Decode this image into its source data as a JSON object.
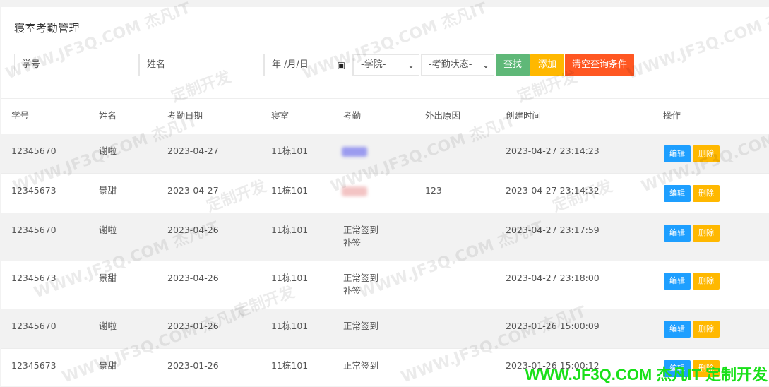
{
  "page": {
    "title": "寝室考勤管理"
  },
  "filters": {
    "student_no_placeholder": "学号",
    "name_placeholder": "姓名",
    "date_placeholder": "年 /月/日",
    "college_select": "-学院-",
    "status_select": "-考勤状态-",
    "search_label": "查找",
    "add_label": "添加",
    "clear_label": "清空查询条件"
  },
  "table": {
    "headers": [
      "学号",
      "姓名",
      "考勤日期",
      "寝室",
      "考勤",
      "外出原因",
      "创建时间",
      "操作"
    ],
    "edit_label": "编辑",
    "delete_label": "删除",
    "rows": [
      {
        "sno": "12345670",
        "name": "谢啦",
        "date": "2023-04-27",
        "room": "11栋101",
        "att1": "",
        "att2": "",
        "reason": "",
        "created": "2023-04-27 23:14:23"
      },
      {
        "sno": "12345673",
        "name": "景甜",
        "date": "2023-04-27",
        "room": "11栋101",
        "att1": "",
        "att2": "",
        "reason": "123",
        "created": "2023-04-27 23:14:32"
      },
      {
        "sno": "12345670",
        "name": "谢啦",
        "date": "2023-04-26",
        "room": "11栋101",
        "att1": "正常签到",
        "att2": "补签",
        "reason": "",
        "created": "2023-04-27 23:17:59"
      },
      {
        "sno": "12345673",
        "name": "景甜",
        "date": "2023-04-26",
        "room": "11栋101",
        "att1": "正常签到",
        "att2": "补签",
        "reason": "",
        "created": "2023-04-27 23:18:00"
      },
      {
        "sno": "12345670",
        "name": "谢啦",
        "date": "2023-01-26",
        "room": "11栋101",
        "att1": "正常签到",
        "att2": "",
        "reason": "",
        "created": "2023-01-26 15:00:09"
      },
      {
        "sno": "12345673",
        "name": "景甜",
        "date": "2023-01-26",
        "room": "11栋101",
        "att1": "正常签到",
        "att2": "",
        "reason": "",
        "created": "2023-01-26 15:00:12"
      }
    ]
  },
  "watermark": {
    "text_a": "WWW.JF3Q.COM 杰凡IT",
    "text_b": "定制开发",
    "banner": "WWW.JF3Q.COM 杰凡IT 定制开发"
  },
  "colors": {
    "search": "#5fb878",
    "add": "#ffb800",
    "clear": "#ff5722",
    "edit": "#1e9fff",
    "delete": "#ffb800",
    "banner": "#19e019"
  }
}
